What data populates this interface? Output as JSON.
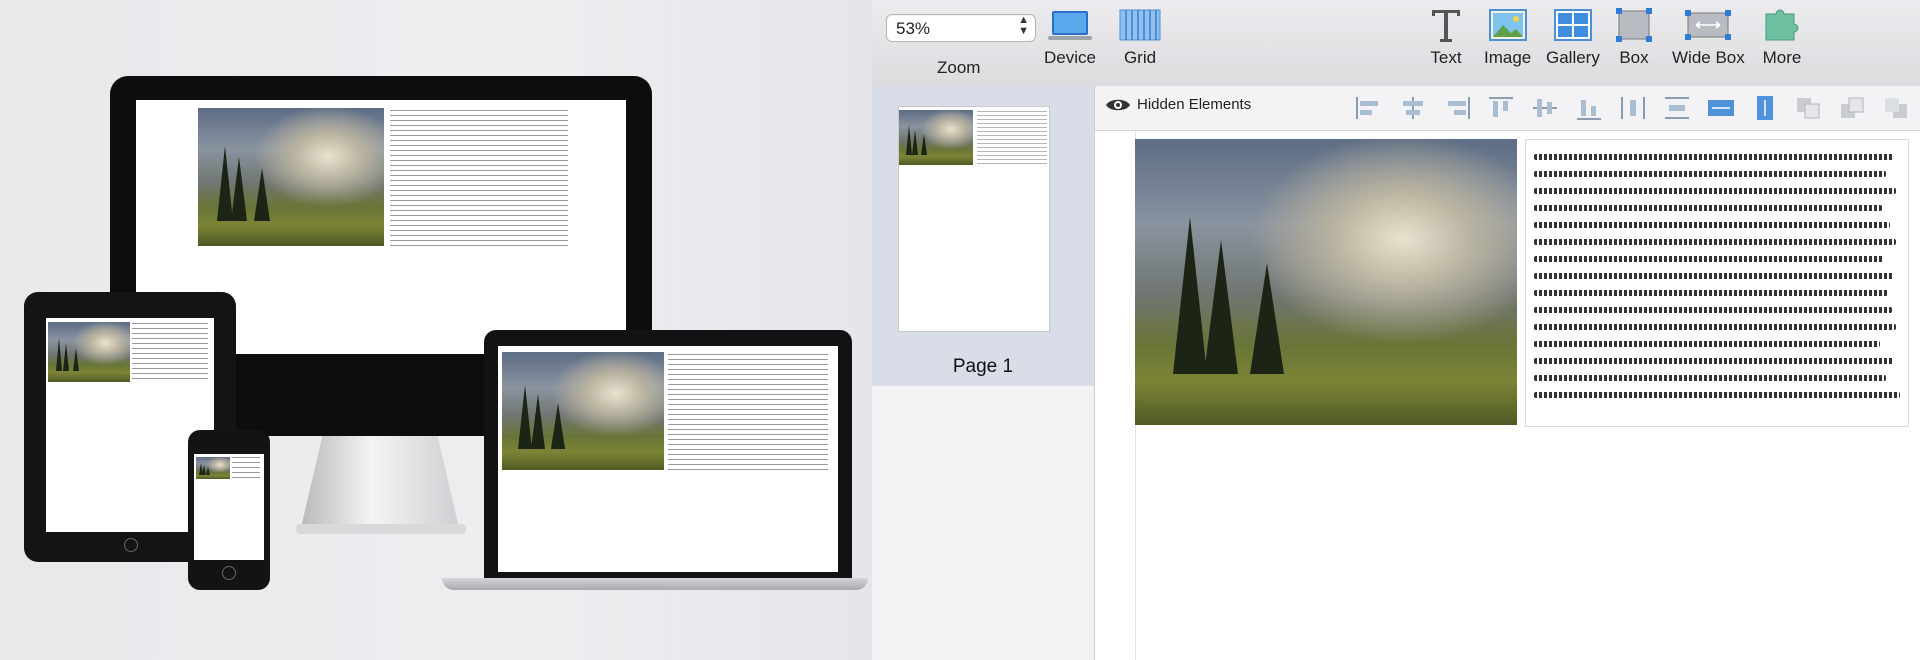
{
  "toolbar": {
    "zoom_value": "53%",
    "zoom_label": "Zoom",
    "device_label": "Device",
    "grid_label": "Grid",
    "text_label": "Text",
    "image_label": "Image",
    "gallery_label": "Gallery",
    "box_label": "Box",
    "wide_box_label": "Wide Box",
    "more_label": "More"
  },
  "sidebar": {
    "pages": [
      {
        "label": "Page 1"
      }
    ]
  },
  "format_bar": {
    "hidden_elements_label": "Hidden Elements",
    "icons": [
      "align-left-icon",
      "align-center-icon",
      "align-right-icon",
      "align-top-icon",
      "align-middle-icon",
      "align-bottom-icon",
      "distribute-horizontal-icon",
      "distribute-vertical-icon",
      "same-width-icon",
      "same-height-icon",
      "bring-forward-icon",
      "bring-to-front-icon",
      "send-backward-icon",
      "send-to-back-icon"
    ]
  },
  "colors": {
    "toolbar_bg": "#dcdcdf",
    "selected_page_bg": "#d8dde8",
    "accent_blue": "#2f7bd6"
  }
}
